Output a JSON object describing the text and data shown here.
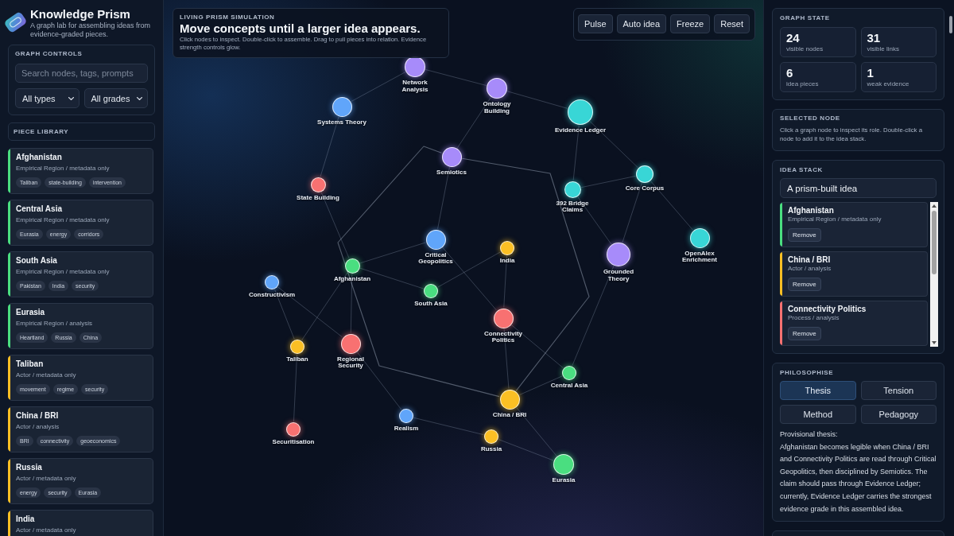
{
  "brand": {
    "title": "Knowledge Prism",
    "subtitle": "A graph lab for assembling ideas from evidence-graded pieces."
  },
  "graph_controls": {
    "title": "GRAPH CONTROLS",
    "search": {
      "placeholder": "Search nodes, tags, prompts"
    },
    "filters": [
      {
        "value": "All types"
      },
      {
        "value": "All grades"
      }
    ]
  },
  "piece_library": {
    "title": "PIECE LIBRARY",
    "pieces": [
      {
        "title": "Afghanistan",
        "meta": "Empirical Region / metadata only",
        "color": "#4ade80",
        "tags": [
          "Taliban",
          "state-building",
          "intervention"
        ]
      },
      {
        "title": "Central Asia",
        "meta": "Empirical Region / metadata only",
        "color": "#4ade80",
        "tags": [
          "Eurasia",
          "energy",
          "corridors"
        ]
      },
      {
        "title": "South Asia",
        "meta": "Empirical Region / metadata only",
        "color": "#4ade80",
        "tags": [
          "Pakistan",
          "India",
          "security"
        ]
      },
      {
        "title": "Eurasia",
        "meta": "Empirical Region / analysis",
        "color": "#4ade80",
        "tags": [
          "Heartland",
          "Russia",
          "China"
        ]
      },
      {
        "title": "Taliban",
        "meta": "Actor / metadata only",
        "color": "#fbbf24",
        "tags": [
          "movement",
          "regime",
          "security"
        ]
      },
      {
        "title": "China / BRI",
        "meta": "Actor / analysis",
        "color": "#fbbf24",
        "tags": [
          "BRI",
          "connectivity",
          "geoeconomics"
        ]
      },
      {
        "title": "Russia",
        "meta": "Actor / metadata only",
        "color": "#fbbf24",
        "tags": [
          "energy",
          "security",
          "Eurasia"
        ]
      },
      {
        "title": "India",
        "meta": "Actor / metadata only",
        "color": "#fbbf24"
      }
    ]
  },
  "simulation": {
    "eyebrow": "LIVING PRISM SIMULATION",
    "title": "Move concepts until a larger idea appears.",
    "description": "Click nodes to inspect. Double-click to assemble. Drag to pull pieces into relation. Evidence strength controls glow.",
    "actions": [
      "Pulse",
      "Auto idea",
      "Freeze",
      "Reset"
    ]
  },
  "graph": {
    "nodes": [
      {
        "label": "Network Analysis",
        "color": "#a78bfa"
      },
      {
        "label": "Ontology Building",
        "color": "#a78bfa"
      },
      {
        "label": "Systems Theory",
        "color": "#60a5fa"
      },
      {
        "label": "Evidence Ledger",
        "color": "#38d6d6"
      },
      {
        "label": "Semiotics",
        "color": "#a78bfa"
      },
      {
        "label": "Core Corpus",
        "color": "#38d6d6"
      },
      {
        "label": "State Building",
        "color": "#f87171"
      },
      {
        "label": "392 Bridge Claims",
        "color": "#38d6d6"
      },
      {
        "label": "Critical Geopolitics",
        "color": "#60a5fa"
      },
      {
        "label": "India",
        "color": "#fbbf24"
      },
      {
        "label": "OpenAlex Enrichment",
        "color": "#38d6d6"
      },
      {
        "label": "Afghanistan",
        "color": "#4ade80"
      },
      {
        "label": "Grounded Theory",
        "color": "#a78bfa"
      },
      {
        "label": "Constructivism",
        "color": "#60a5fa"
      },
      {
        "label": "South Asia",
        "color": "#4ade80"
      },
      {
        "label": "Connectivity Politics",
        "color": "#f87171"
      },
      {
        "label": "Taliban",
        "color": "#fbbf24"
      },
      {
        "label": "Regional Security",
        "color": "#f87171"
      },
      {
        "label": "Central Asia",
        "color": "#4ade80"
      },
      {
        "label": "China / BRI",
        "color": "#fbbf24"
      },
      {
        "label": "Realism",
        "color": "#60a5fa"
      },
      {
        "label": "Securitisation",
        "color": "#f87171"
      },
      {
        "label": "Russia",
        "color": "#fbbf24"
      },
      {
        "label": "Eurasia",
        "color": "#4ade80"
      }
    ]
  },
  "graph_state": {
    "title": "GRAPH STATE",
    "stats": [
      {
        "value": "24",
        "label": "visible nodes"
      },
      {
        "value": "31",
        "label": "visible links"
      },
      {
        "value": "6",
        "label": "idea pieces"
      },
      {
        "value": "1",
        "label": "weak evidence"
      }
    ]
  },
  "selected_node": {
    "title": "SELECTED NODE",
    "hint": "Click a graph node to inspect its role. Double-click a node to add it to the idea stack."
  },
  "idea_stack": {
    "title": "IDEA STACK",
    "name": {
      "value": "A prism-built idea"
    },
    "items": [
      {
        "title": "Afghanistan",
        "meta": "Empirical Region / metadata only",
        "color": "#4ade80",
        "action": "Remove"
      },
      {
        "title": "China / BRI",
        "meta": "Actor / analysis",
        "color": "#fbbf24",
        "action": "Remove"
      },
      {
        "title": "Connectivity Politics",
        "meta": "Process / analysis",
        "color": "#f87171",
        "action": "Remove"
      }
    ]
  },
  "philosophise": {
    "title": "PHILOSOPHISE",
    "modes": [
      {
        "label": "Thesis",
        "selected": true
      },
      {
        "label": "Tension",
        "selected": false
      },
      {
        "label": "Method",
        "selected": false
      },
      {
        "label": "Pedagogy",
        "selected": false
      }
    ],
    "heading": "Provisional thesis:",
    "text": "Afghanistan becomes legible when China / BRI and Connectivity Politics are read through Critical Geopolitics, then disciplined by Semiotics. The claim should pass through Evidence Ledger; currently, Evidence Ledger carries the strongest evidence grade in this assembled idea."
  }
}
